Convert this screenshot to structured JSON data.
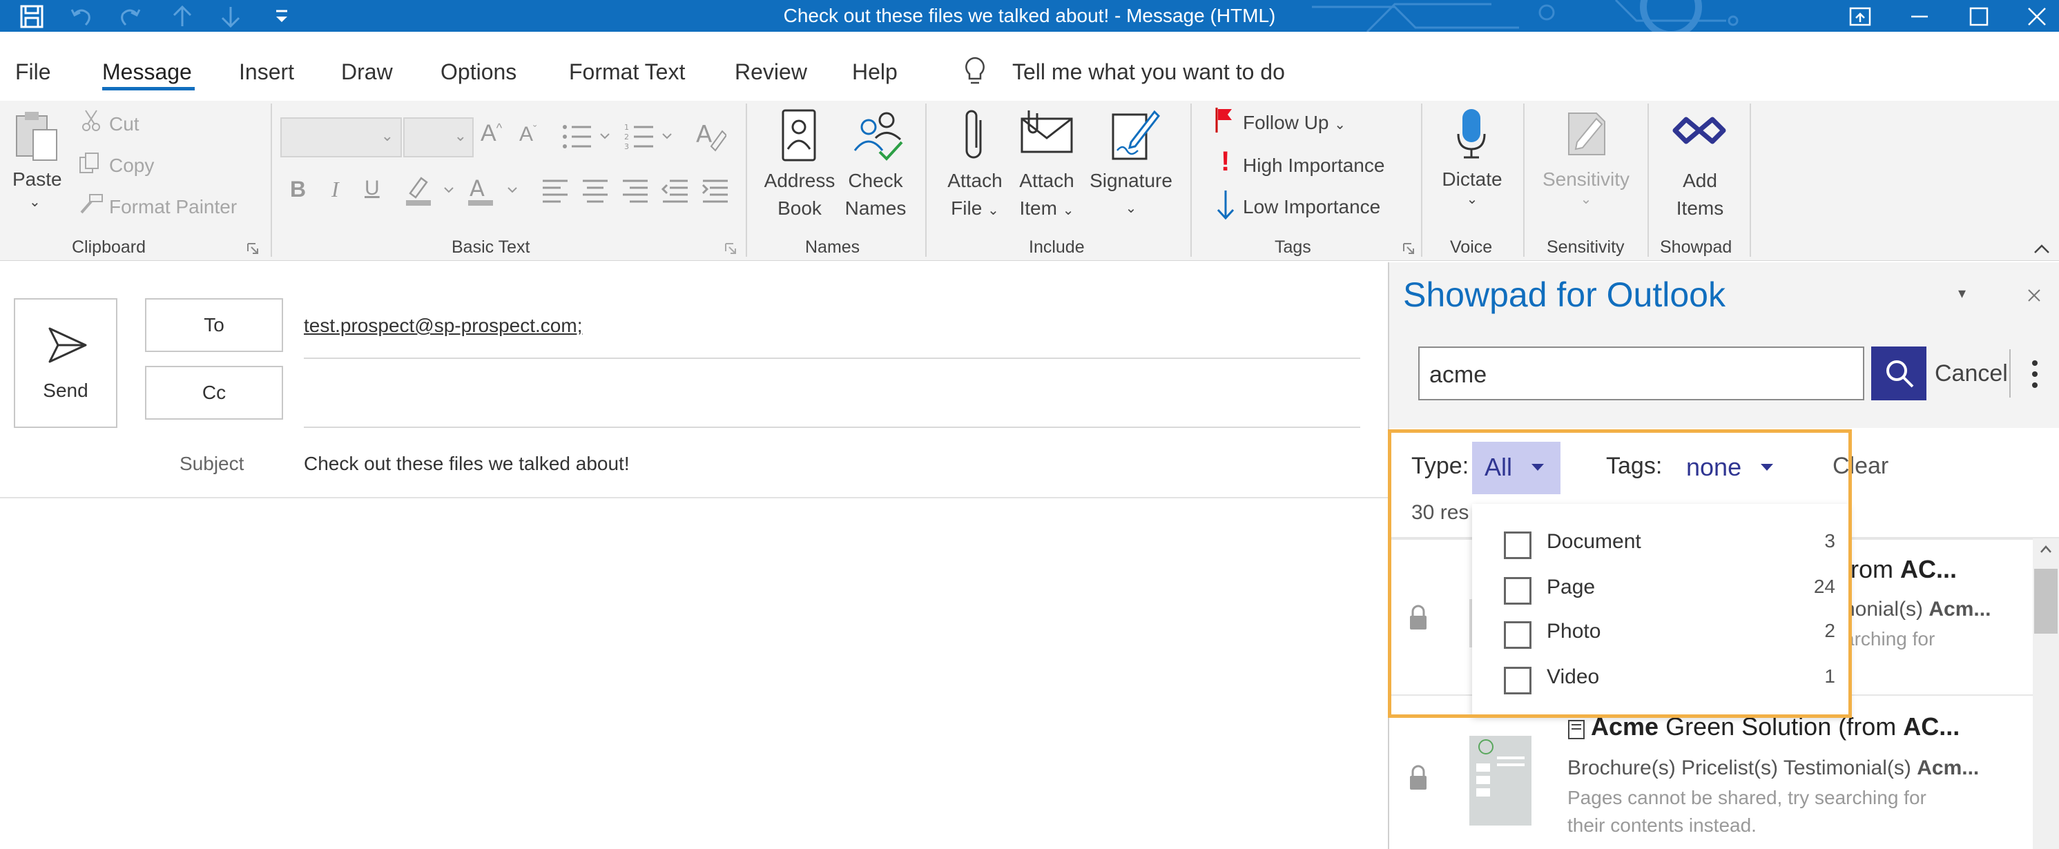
{
  "window": {
    "title": "Check out these files we talked about!  -  Message (HTML)"
  },
  "tabs": [
    "File",
    "Message",
    "Insert",
    "Draw",
    "Options",
    "Format Text",
    "Review",
    "Help"
  ],
  "tell_me": "Tell me what you want to do",
  "clipboard": {
    "paste": "Paste",
    "cut": "Cut",
    "copy": "Copy",
    "format_painter": "Format Painter",
    "label": "Clipboard"
  },
  "basic_text": {
    "label": "Basic Text"
  },
  "names": {
    "address_book": [
      "Address",
      "Book"
    ],
    "check_names": [
      "Check",
      "Names"
    ],
    "label": "Names"
  },
  "include": {
    "attach_file": [
      "Attach",
      "File"
    ],
    "attach_item": [
      "Attach",
      "Item"
    ],
    "signature": "Signature",
    "label": "Include"
  },
  "tags": {
    "follow_up": "Follow Up",
    "high_importance": "High Importance",
    "low_importance": "Low Importance",
    "label": "Tags"
  },
  "voice": {
    "dictate": "Dictate",
    "label": "Voice"
  },
  "sensitivity": {
    "button": "Sensitivity",
    "label": "Sensitivity"
  },
  "showpad_group": {
    "add_items": [
      "Add",
      "Items"
    ],
    "label": "Showpad"
  },
  "compose": {
    "send": "Send",
    "to_button": "To",
    "cc_button": "Cc",
    "to_value": "test.prospect@sp-prospect.com;",
    "subject_label": "Subject",
    "subject_value": "Check out these files we talked about!"
  },
  "showpad": {
    "title": "Showpad for Outlook",
    "search_value": "acme",
    "cancel": "Cancel",
    "type_label": "Type:",
    "type_value": "All",
    "tags_label": "Tags:",
    "tags_value": "none",
    "clear": "Clear",
    "results_count_partial": "30 res",
    "type_options": [
      {
        "label": "Document",
        "count": "3"
      },
      {
        "label": "Page",
        "count": "24"
      },
      {
        "label": "Photo",
        "count": "2"
      },
      {
        "label": "Video",
        "count": "1"
      }
    ],
    "result1": {
      "title_partial_a": "from ",
      "title_partial_b": "AC...",
      "tags_partial_a": "nonial(s) ",
      "tags_partial_b": "Acm...",
      "note_partial": "arching for"
    },
    "result2": {
      "title_bold": "Acme",
      "title_rest": " Green Solution (from ",
      "title_bold2": "AC...",
      "tags_a": "Brochure(s) Pricelist(s) Testimonial(s)  ",
      "tags_b": "Acm...",
      "note_line1": "Pages cannot be shared, try searching for",
      "note_line2": "their contents instead."
    }
  },
  "colors": {
    "accent": "#106ebe",
    "search_button": "#2f3592",
    "highlight": "#f2b046",
    "follow_up_flag": "#e81123"
  }
}
